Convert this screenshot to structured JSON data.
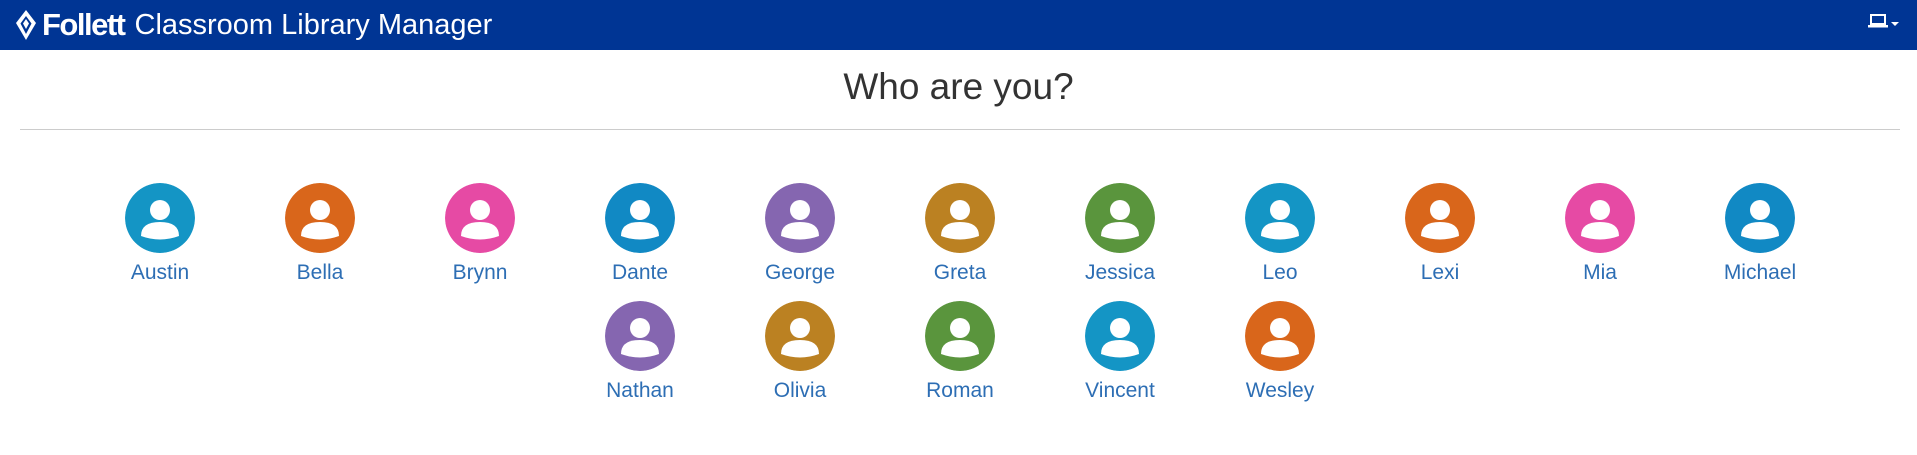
{
  "header": {
    "brand": "Follett",
    "app_name": "Classroom Library Manager",
    "logo_icon": "follett-logo-icon",
    "menu_icon": "laptop-icon",
    "bar_color": "#003594"
  },
  "page": {
    "title": "Who are you?"
  },
  "users": [
    {
      "name": "Austin",
      "color": "#1495c5"
    },
    {
      "name": "Bella",
      "color": "#d9661b"
    },
    {
      "name": "Brynn",
      "color": "#e64aa4"
    },
    {
      "name": "Dante",
      "color": "#1189c4"
    },
    {
      "name": "George",
      "color": "#8566b0"
    },
    {
      "name": "Greta",
      "color": "#bb8122"
    },
    {
      "name": "Jessica",
      "color": "#5a953d"
    },
    {
      "name": "Leo",
      "color": "#1495c5"
    },
    {
      "name": "Lexi",
      "color": "#d9661b"
    },
    {
      "name": "Mia",
      "color": "#e64aa4"
    },
    {
      "name": "Michael",
      "color": "#1189c4"
    },
    {
      "name": "Nathan",
      "color": "#8566b0"
    },
    {
      "name": "Olivia",
      "color": "#bb8122"
    },
    {
      "name": "Roman",
      "color": "#5a953d"
    },
    {
      "name": "Vincent",
      "color": "#1495c5"
    },
    {
      "name": "Wesley",
      "color": "#d9661b"
    }
  ]
}
